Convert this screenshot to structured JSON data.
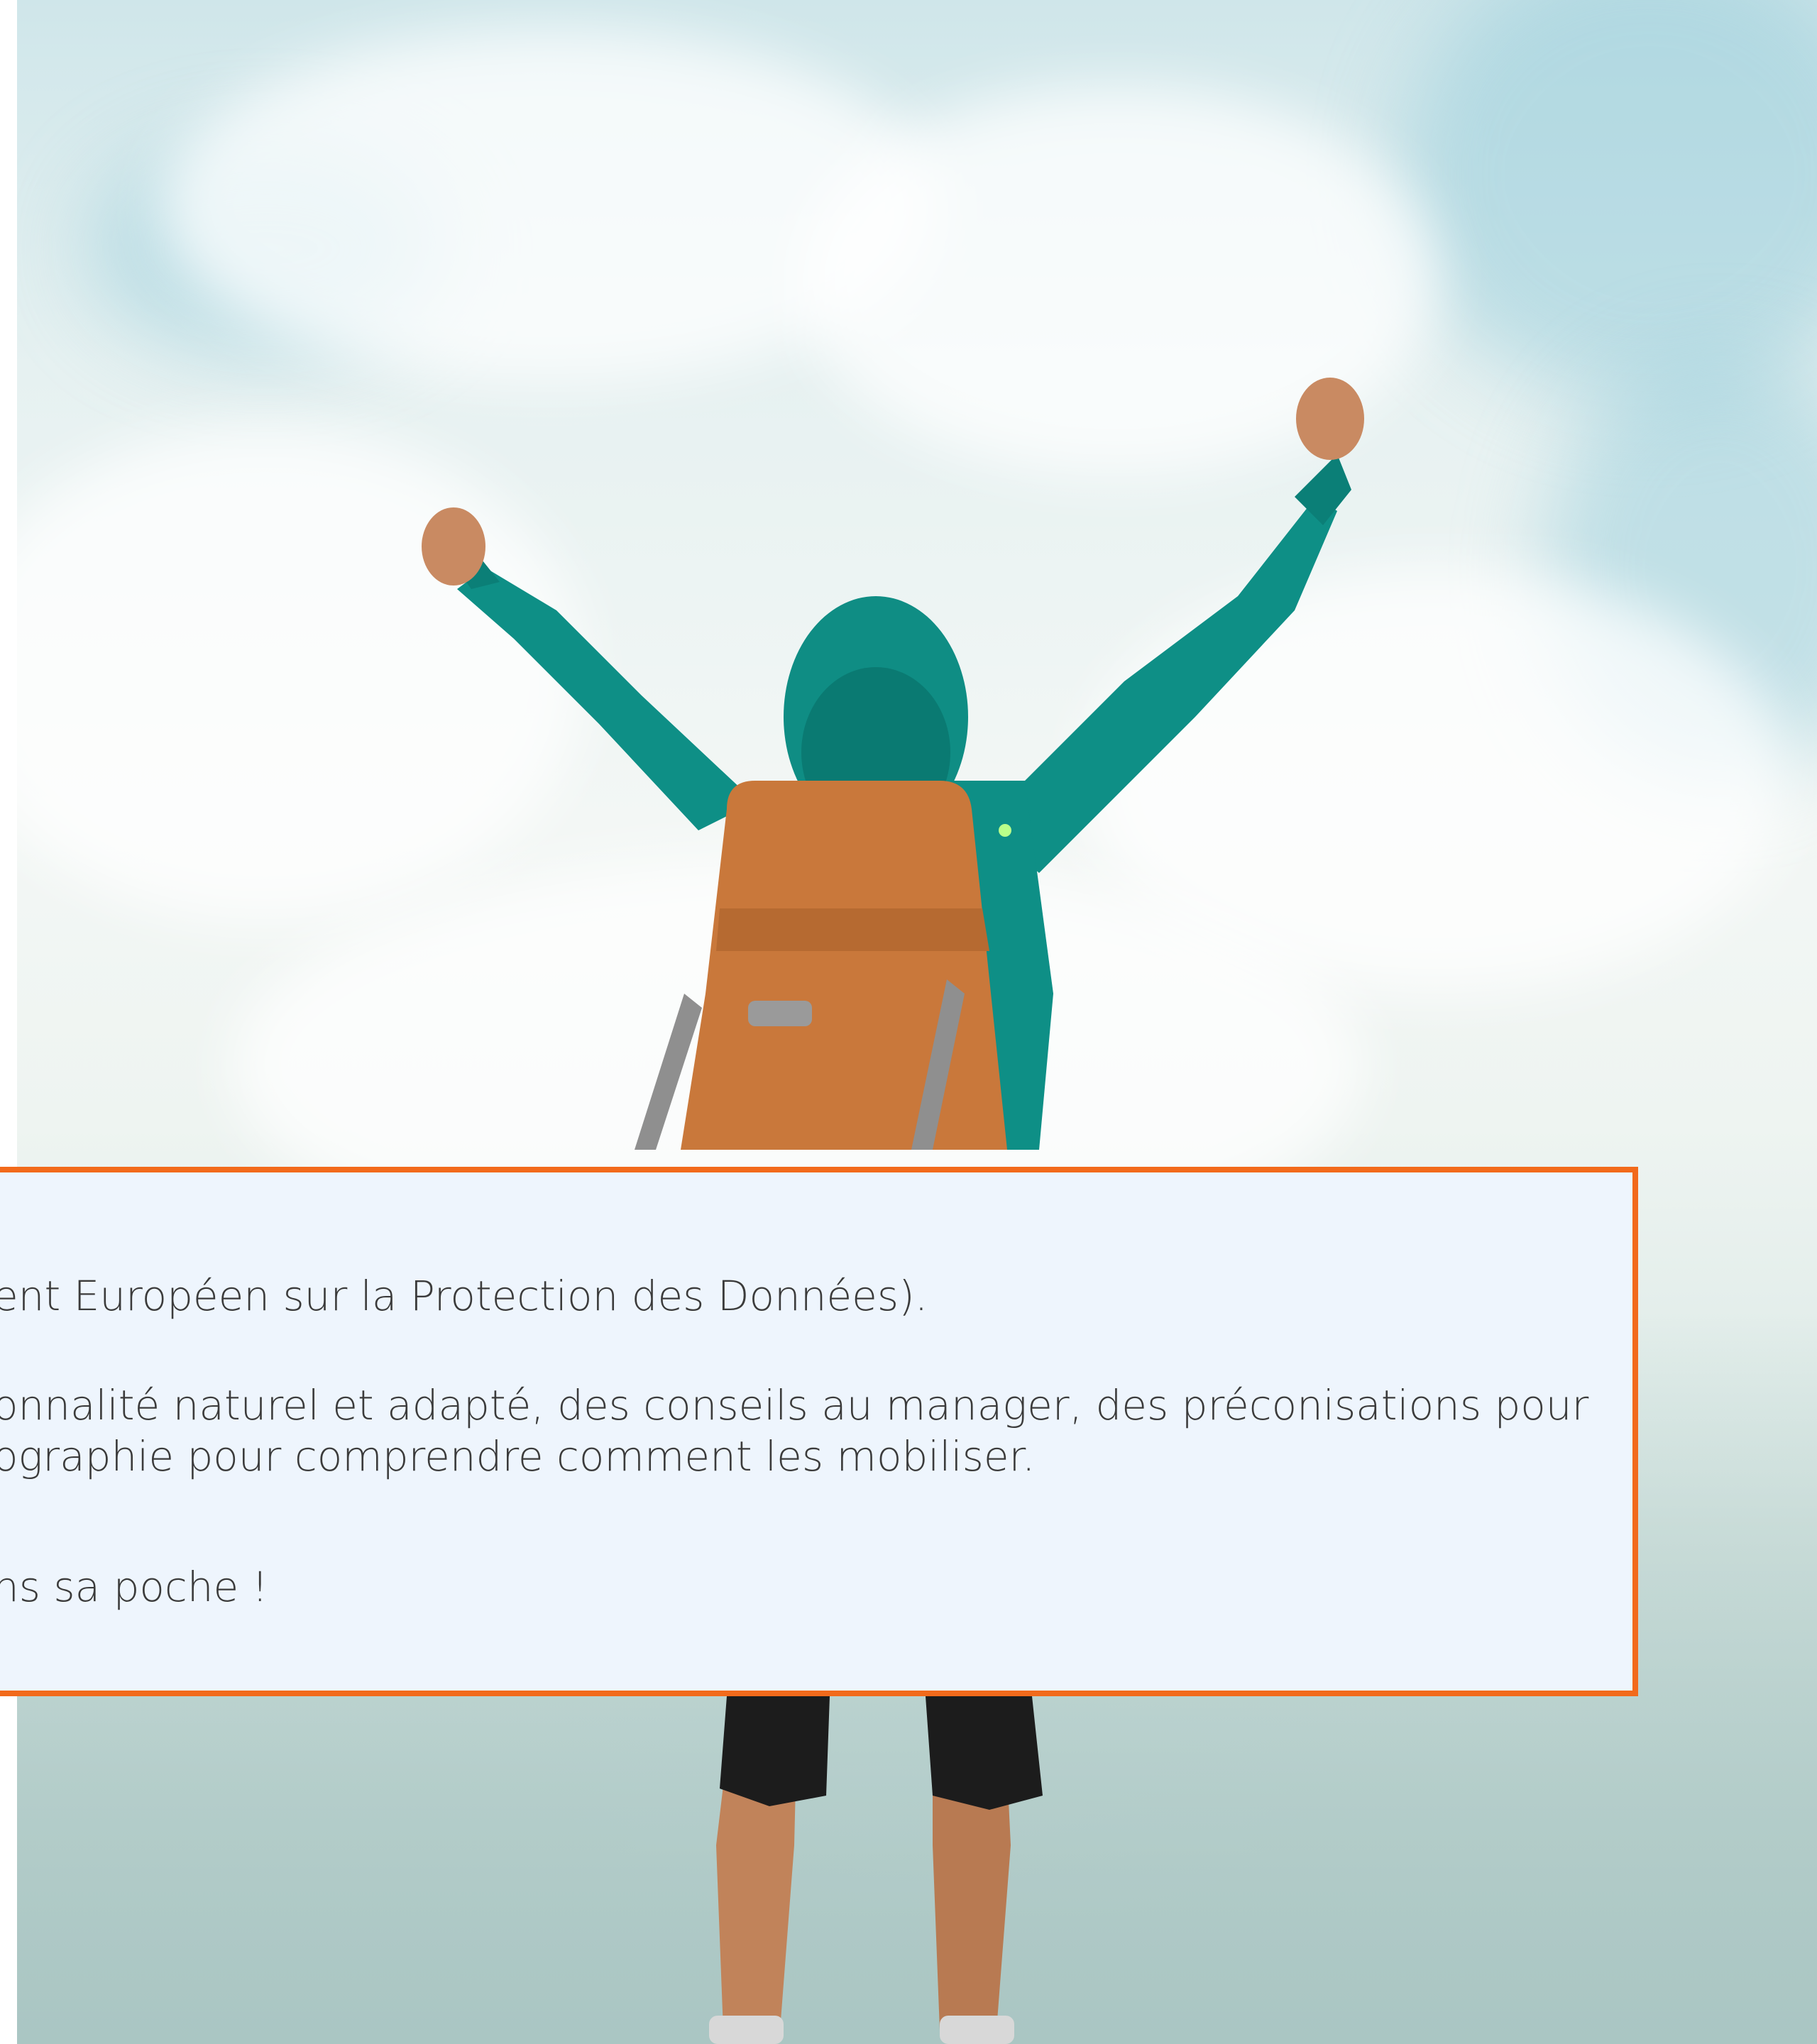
{
  "hero": {
    "image_icon": "hiker-celebrating-photo"
  },
  "info_panel": {
    "line1": "ent Européen sur la Protection des Données).",
    "line2": "onnalité naturel et adapté, des conseils au manager, des préconisations pour",
    "line3": "ographie pour comprendre comment les mobiliser.",
    "line4": "ns sa poche !"
  },
  "colors": {
    "panel_border": "#f26a1b",
    "panel_background": "#eef5fd",
    "text": "#3b3b3b"
  }
}
